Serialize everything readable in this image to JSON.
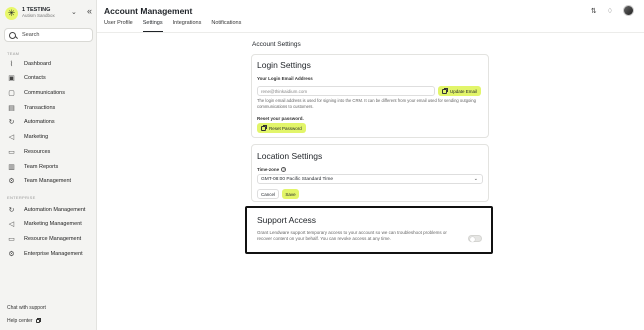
{
  "workspace": {
    "name": "1 TESTING",
    "subtitle": "Autism Sandbox"
  },
  "sidebar": {
    "search_label": "Search",
    "team_label": "TEAM",
    "team_items": [
      {
        "label": "Dashboard",
        "icon": "chart-icon"
      },
      {
        "label": "Contacts",
        "icon": "contacts-icon"
      },
      {
        "label": "Communications",
        "icon": "chat-icon"
      },
      {
        "label": "Transactions",
        "icon": "transactions-icon"
      },
      {
        "label": "Automations",
        "icon": "refresh-icon"
      },
      {
        "label": "Marketing",
        "icon": "megaphone-icon"
      },
      {
        "label": "Resources",
        "icon": "folder-icon"
      },
      {
        "label": "Team Reports",
        "icon": "report-icon"
      },
      {
        "label": "Team Management",
        "icon": "gear-icon"
      }
    ],
    "enterprise_label": "ENTERPRISE",
    "enterprise_items": [
      {
        "label": "Automation Management",
        "icon": "refresh-icon"
      },
      {
        "label": "Marketing Management",
        "icon": "megaphone-icon"
      },
      {
        "label": "Resource Management",
        "icon": "folder-icon"
      },
      {
        "label": "Enterprise Management",
        "icon": "gear-icon"
      }
    ],
    "chat_support": "Chat with support",
    "help_center": "Help center"
  },
  "header": {
    "title": "Account Management",
    "tabs": [
      {
        "label": "User Profile",
        "active": false
      },
      {
        "label": "Settings",
        "active": true
      },
      {
        "label": "Integrations",
        "active": false
      },
      {
        "label": "Notifications",
        "active": false
      }
    ]
  },
  "settings": {
    "title": "Account Settings",
    "login": {
      "heading": "Login Settings",
      "email_label": "Your Login Email Address",
      "email_placeholder": "rene@thinkaidium.com",
      "update_button": "Update Email",
      "email_help": "The login email address is used for signing into the CRM. It can be different from your email used for sending outgoing communications to customers.",
      "reset_label": "Reset your password.",
      "reset_button": "Reset Password"
    },
    "location": {
      "heading": "Location Settings",
      "timezone_label": "Time-zone",
      "timezone_value": "GMT-08:00 Pacific Standard Time",
      "cancel_button": "Cancel",
      "save_button": "Save"
    },
    "support": {
      "heading": "Support Access",
      "description": "Grant Lendware support temporary access to your account so we can troubleshoot problems or recover content on your behalf. You can revoke access at any time.",
      "enabled": false
    }
  },
  "colors": {
    "accent": "#e2f56a",
    "sidebar_bg": "#f4f4f2",
    "highlight_border": "#111111"
  }
}
